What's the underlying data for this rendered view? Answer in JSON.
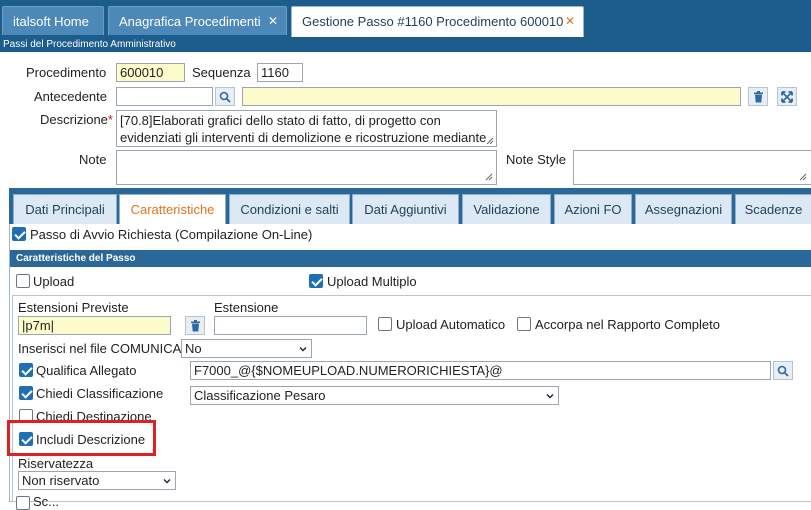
{
  "top_tabs": [
    {
      "label": "italsoft Home"
    },
    {
      "label": "Anagrafica Procedimenti",
      "close": "✕"
    },
    {
      "label": "Gestione Passo #1160 Procedimento 600010",
      "close": "✕"
    }
  ],
  "subheader": "Passi del Procedimento Amministrativo",
  "form": {
    "procedimento_label": "Procedimento",
    "procedimento_value": "600010",
    "sequenza_label": "Sequenza",
    "sequenza_value": "1160",
    "antecedente_label": "Antecedente",
    "antecedente_value": "",
    "antecedente_desc": "",
    "descrizione_label": "Descrizione",
    "descrizione_required": "*",
    "descrizione_line1": "[70.8]Elaborati grafici dello stato di fatto, di progetto con",
    "descrizione_line2": "evidenziati gli interventi di demolizione e ricostruzione mediante",
    "note_label": "Note",
    "note_value": "",
    "note_style_label": "Note Style",
    "note_style_value": ""
  },
  "inner_tabs": [
    {
      "label": "Dati Principali"
    },
    {
      "label": "Caratteristiche"
    },
    {
      "label": "Condizioni e salti"
    },
    {
      "label": "Dati Aggiuntivi"
    },
    {
      "label": "Validazione"
    },
    {
      "label": "Azioni FO"
    },
    {
      "label": "Assegnazioni"
    },
    {
      "label": "Scadenze"
    }
  ],
  "caratteristiche": {
    "passo_avvio_label": "Passo di Avvio Richiesta (Compilazione On-Line)",
    "passo_avvio_checked": true,
    "section_title": "Caratteristiche del Passo",
    "upload_label": "Upload",
    "upload_checked": false,
    "upload_multiplo_label": "Upload Multiplo",
    "upload_multiplo_checked": true,
    "estensioni_previste_label": "Estensioni Previste",
    "estensioni_previste_value": "|p7m|",
    "estensione_label": "Estensione",
    "estensione_value": "",
    "upload_automatico_label": "Upload Automatico",
    "upload_automatico_checked": false,
    "accorpa_label": "Accorpa nel Rapporto Completo",
    "accorpa_checked": false,
    "inserisci_comunica_label": "Inserisci nel file COMUNICA",
    "inserisci_comunica_value": "No",
    "qualifica_allegato_label": "Qualifica Allegato",
    "qualifica_allegato_checked": true,
    "qualifica_allegato_value": "F7000_@{$NOMEUPLOAD.NUMERORICHIESTA}@",
    "chiedi_classificazione_label": "Chiedi Classificazione",
    "chiedi_classificazione_checked": true,
    "classificazione_value": "Classificazione Pesaro",
    "chiedi_destinazione_label": "Chiedi Destinazione",
    "chiedi_destinazione_checked": false,
    "includi_descrizione_label": "Includi Descrizione",
    "includi_descrizione_checked": true,
    "riservatezza_label": "Riservatezza",
    "riservatezza_value": "Non riservato",
    "bottom_partial_label": "Sc..."
  },
  "colors": {
    "header_blue": "#1d5d8c",
    "active_accent": "#e2731e",
    "checkbox_blue": "#1f6fb5",
    "highlight_red": "#e02020",
    "input_yellow": "#fdfbcc"
  }
}
